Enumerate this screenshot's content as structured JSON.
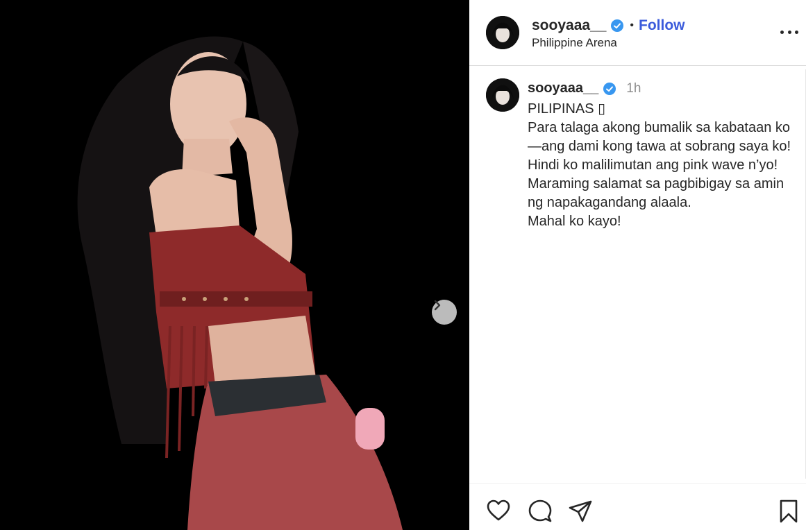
{
  "post": {
    "media": {
      "description_icon": "performer-photo",
      "next_icon": "chevron-right-icon"
    },
    "header": {
      "username": "sooyaaa__",
      "separator": "•",
      "follow_label": "Follow",
      "location": "Philippine Arena",
      "more_icon": "more-horizontal-icon"
    },
    "caption": {
      "username": "sooyaaa__",
      "time": "1h",
      "lines": [
        "PILIPINAS ▯",
        "Para talaga akong bumalik sa kabataan ko—ang dami kong tawa at sobrang saya ko!",
        "Hindi ko malilimutan ang pink wave n’yo!",
        "Maraming salamat sa pagbibigay sa amin ng napakagandang alaala.",
        "Mahal ko kayo!"
      ]
    },
    "actions": {
      "like_icon": "heart-icon",
      "comment_icon": "comment-icon",
      "share_icon": "share-icon",
      "save_icon": "bookmark-icon"
    },
    "colors": {
      "follow": "#3b5bdb",
      "verified": "#3897f0",
      "outfit": "#8e2a2a"
    }
  }
}
